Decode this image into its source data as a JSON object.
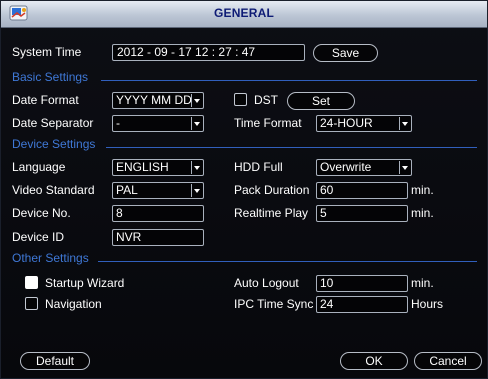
{
  "window": {
    "title": "GENERAL"
  },
  "system_time": {
    "label": "System Time",
    "value": "2012 - 09 - 17  12 : 27 : 47",
    "save_label": "Save"
  },
  "sections": {
    "basic": "Basic Settings",
    "device": "Device Settings",
    "other": "Other Settings"
  },
  "basic": {
    "date_format_label": "Date Format",
    "date_format_value": "YYYY MM DD",
    "dst_label": "DST",
    "dst_set_label": "Set",
    "date_separator_label": "Date Separator",
    "date_separator_value": "-",
    "time_format_label": "Time Format",
    "time_format_value": "24-HOUR"
  },
  "device": {
    "language_label": "Language",
    "language_value": "ENGLISH",
    "hdd_full_label": "HDD Full",
    "hdd_full_value": "Overwrite",
    "video_standard_label": "Video Standard",
    "video_standard_value": "PAL",
    "pack_duration_label": "Pack Duration",
    "pack_duration_value": "60",
    "pack_duration_unit": "min.",
    "device_no_label": "Device No.",
    "device_no_value": "8",
    "realtime_play_label": "Realtime Play",
    "realtime_play_value": "5",
    "realtime_play_unit": "min.",
    "device_id_label": "Device ID",
    "device_id_value": "NVR"
  },
  "other": {
    "startup_wizard_label": "Startup Wizard",
    "startup_wizard_checked": true,
    "navigation_label": "Navigation",
    "navigation_checked": false,
    "auto_logout_label": "Auto Logout",
    "auto_logout_value": "10",
    "auto_logout_unit": "min.",
    "ipc_time_sync_label": "IPC Time Sync",
    "ipc_time_sync_value": "24",
    "ipc_time_sync_unit": "Hours"
  },
  "footer": {
    "default_label": "Default",
    "ok_label": "OK",
    "cancel_label": "Cancel"
  },
  "colors": {
    "section_text": "#3f78d6",
    "title_text": "#0e1b75"
  }
}
